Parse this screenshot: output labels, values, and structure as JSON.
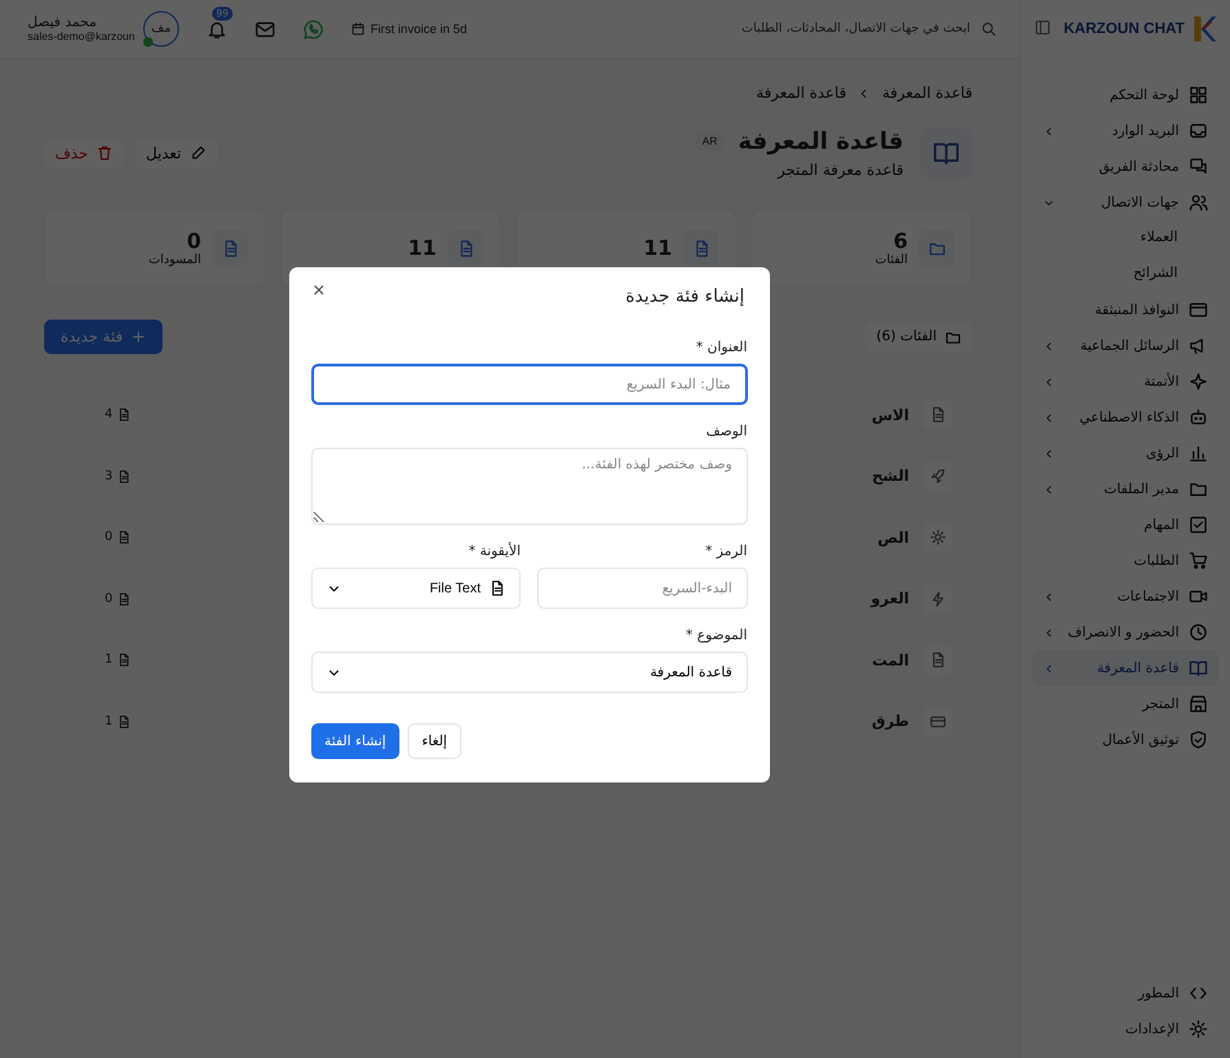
{
  "topbar": {
    "brand": "KARZOUN CHAT",
    "search": {
      "placeholder": "ابحث في جهات الاتصال، المحادثات، الطلبات"
    },
    "invoice": "First invoice in 5d",
    "notification_badge": "99",
    "user": {
      "name": "محمد فيصل",
      "email": "sales-demo@karzoun",
      "avatar": "مف",
      "online": true
    }
  },
  "sidebar": {
    "items": [
      {
        "label": "لوحة التحكم",
        "selected": false,
        "expandable": false
      },
      {
        "label": "البريد الوارد",
        "selected": false,
        "expandable": true
      },
      {
        "label": "محادثة الفريق",
        "selected": false,
        "expandable": false
      },
      {
        "label": "جهات الاتصال",
        "selected": false,
        "expandable": true,
        "expanded": true,
        "children": [
          {
            "label": "العملاء"
          },
          {
            "label": "الشرائح"
          }
        ]
      },
      {
        "label": "النوافذ المنبثقة",
        "selected": false,
        "expandable": false
      },
      {
        "label": "الرسائل الجماعية",
        "selected": false,
        "expandable": true
      },
      {
        "label": "الأتمتة",
        "selected": false,
        "expandable": true
      },
      {
        "label": "الذكاء الاصطناعي",
        "selected": false,
        "expandable": true
      },
      {
        "label": "الرؤى",
        "selected": false,
        "expandable": true
      },
      {
        "label": "مدير الملفات",
        "selected": false,
        "expandable": true
      },
      {
        "label": "المهام",
        "selected": false,
        "expandable": false
      },
      {
        "label": "الطلبات",
        "selected": false,
        "expandable": false
      },
      {
        "label": "الاجتماعات",
        "selected": false,
        "expandable": true
      },
      {
        "label": "الحضور و الانصراف",
        "selected": false,
        "expandable": true
      },
      {
        "label": "قاعدة المعرفة",
        "selected": true,
        "expandable": true
      },
      {
        "label": "المتجر",
        "selected": false,
        "expandable": false
      },
      {
        "label": "توثيق الأعمال",
        "selected": false,
        "expandable": false
      }
    ],
    "footer": [
      {
        "label": "المطور"
      },
      {
        "label": "الإعدادات"
      }
    ]
  },
  "breadcrumb": [
    "قاعدة المعرفة",
    "قاعدة المعرفة"
  ],
  "header": {
    "title": "قاعدة المعرفة",
    "language": "AR",
    "subtitle": "قاعدة معرفة المتجر",
    "edit": "تعديل",
    "delete": "حذف"
  },
  "stats": [
    {
      "value": "6",
      "label": "الفئات"
    },
    {
      "value": "11"
    },
    {
      "value": "11"
    },
    {
      "value": "0",
      "label": "المسودات"
    }
  ],
  "categories_tab": "الفئات (6)",
  "new_category": "فئة جديدة",
  "rows": [
    {
      "title": "الاس",
      "count": "4"
    },
    {
      "title": "الشح",
      "count": "3"
    },
    {
      "title": "الص",
      "count": "0"
    },
    {
      "title": "العرو",
      "count": "0"
    },
    {
      "title": "المت",
      "count": "1"
    },
    {
      "title": "طرق",
      "count": "1"
    }
  ],
  "modal": {
    "title": "إنشاء فئة جديدة",
    "fields": [
      {
        "kind": "text",
        "label": "العنوان *",
        "placeholder": "مثال: البدء السريع",
        "focused": true
      },
      {
        "kind": "textarea",
        "label": "الوصف",
        "placeholder": "وصف مختصر لهذه الفئة..."
      },
      {
        "kind": "pair",
        "items": [
          {
            "kind": "text",
            "label": "الرمز *",
            "placeholder": "البدء-السريع"
          },
          {
            "kind": "select",
            "label": "الأيقونة *",
            "value": "File Text",
            "with_icon": true
          }
        ]
      },
      {
        "kind": "select",
        "label": "الموضوع *",
        "value": "قاعدة المعرفة"
      }
    ],
    "buttons": [
      {
        "label": "إلغاء",
        "primary": false
      },
      {
        "label": "إنشاء الفئة",
        "primary": true
      }
    ]
  }
}
